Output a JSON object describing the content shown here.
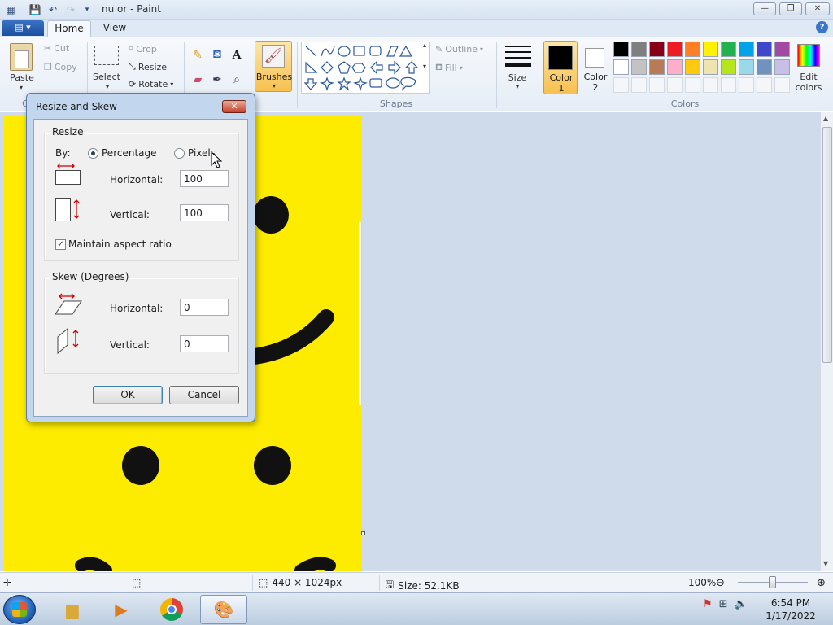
{
  "window": {
    "title": "nu or - Paint",
    "min": "—",
    "max": "❐",
    "close": "✕"
  },
  "ribbon_tabs": {
    "file": "▤ ▾",
    "home": "Home",
    "view": "View",
    "help": "?"
  },
  "clipboard": {
    "paste": "Paste",
    "cut": "Cut",
    "copy": "Copy",
    "group_label": "C"
  },
  "image": {
    "select": "Select",
    "crop": "Crop",
    "resize": "Resize",
    "rotate": "Rotate"
  },
  "tools_group": {
    "brushes": "Brushes"
  },
  "shapes": {
    "outline": "Outline",
    "fill": "Fill",
    "group_label": "Shapes"
  },
  "size_group": {
    "size": "Size"
  },
  "colors": {
    "color1": "Color\n1",
    "color1_line1": "Color",
    "color1_line2": "1",
    "color2_line1": "Color",
    "color2_line2": "2",
    "edit_line1": "Edit",
    "edit_line2": "colors",
    "group_label": "Colors",
    "color1_value": "#000000",
    "color2_value": "#ffffff",
    "palette_row1": [
      "#000000",
      "#7f7f7f",
      "#880015",
      "#ed1c24",
      "#ff7f27",
      "#fff200",
      "#22b14c",
      "#00a2e8",
      "#3f48cc",
      "#a349a4"
    ],
    "palette_row2": [
      "#ffffff",
      "#c3c3c3",
      "#b97a57",
      "#ffaec9",
      "#ffc90e",
      "#efe4b0",
      "#b5e61d",
      "#99d9ea",
      "#7092be",
      "#c8bfe7"
    ]
  },
  "canvas": {
    "background": "#fdec00"
  },
  "dialog": {
    "title": "Resize and Skew",
    "close": "✕",
    "resize_legend": "Resize",
    "by_label": "By:",
    "percentage": "Percentage",
    "pixels": "Pixels",
    "horizontal_label": "Horizontal:",
    "horizontal_value": "100",
    "vertical_label": "Vertical:",
    "vertical_value": "100",
    "maintain": "Maintain aspect ratio",
    "maintain_checked": "✓",
    "skew_legend": "Skew (Degrees)",
    "skew_h_label": "Horizontal:",
    "skew_h_value": "0",
    "skew_v_label": "Vertical:",
    "skew_v_value": "0",
    "ok": "OK",
    "cancel": "Cancel"
  },
  "status": {
    "dimensions": "440 × 1024px",
    "size": "Size: 52.1KB",
    "zoom": "100%"
  },
  "taskbar": {
    "time": "6:54 PM",
    "date": "1/17/2022"
  }
}
